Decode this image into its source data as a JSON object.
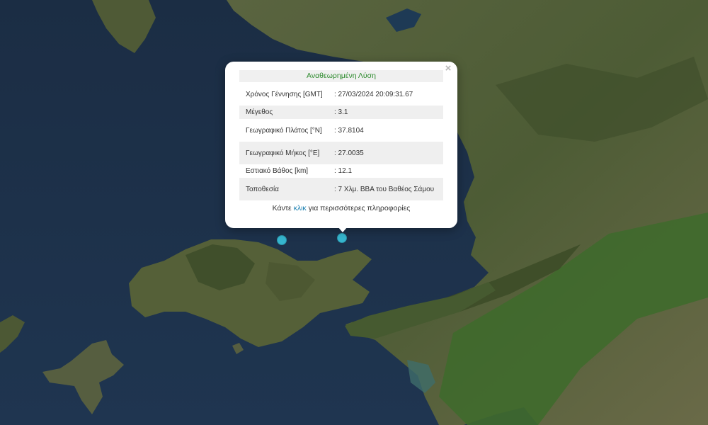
{
  "popup": {
    "title": "Αναθεωρημένη Λύση",
    "close_symbol": "×",
    "rows": [
      {
        "label": "Χρόνος Γέννησης [GMT]",
        "value": ": 27/03/2024 20:09:31.67"
      },
      {
        "label": "Μέγεθος",
        "value": ": 3.1"
      },
      {
        "label": "Γεωγραφικό Πλάτος [°N]",
        "value": ": 37.8104"
      },
      {
        "label": "Γεωγραφικό Μήκος [°E]",
        "value": ": 27.0035"
      },
      {
        "label": "Εστιακό Βάθος [km]",
        "value": ": 12.1"
      },
      {
        "label": "Τοποθεσία",
        "value": ": 7 Χλμ. ΒΒΑ του Βαθέος Σάμου"
      }
    ],
    "footer": {
      "before": "Κάντε ",
      "link": "κλικ",
      "after": " για περισσότερες πληροφορίες"
    }
  },
  "map": {
    "style": "satellite",
    "colors": {
      "sea": "#1e3147",
      "land": "#4a5a36",
      "marker": "#36b6cf"
    },
    "markers": [
      "earthquake-marker",
      "earthquake-marker-selected"
    ]
  }
}
